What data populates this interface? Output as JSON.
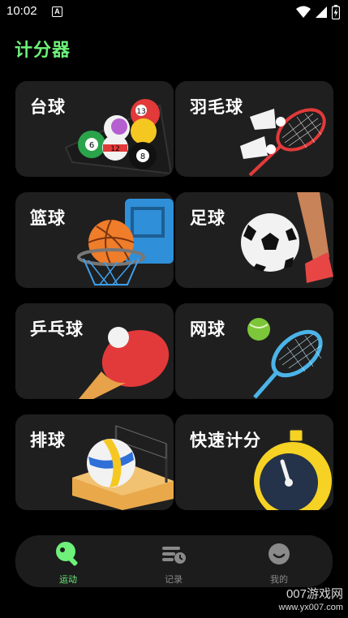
{
  "status_bar": {
    "time": "10:02",
    "notification_letter": "A"
  },
  "app": {
    "title": "计分器"
  },
  "sports": [
    {
      "label": "台球"
    },
    {
      "label": "羽毛球"
    },
    {
      "label": "篮球"
    },
    {
      "label": "足球"
    },
    {
      "label": "乒乓球"
    },
    {
      "label": "网球"
    },
    {
      "label": "排球"
    },
    {
      "label": "快速计分"
    }
  ],
  "nav": {
    "items": [
      {
        "label": "运动",
        "active": true,
        "icon": "ping-pong-paddle-icon"
      },
      {
        "label": "记录",
        "active": false,
        "icon": "records-icon"
      },
      {
        "label": "我的",
        "active": false,
        "icon": "profile-icon"
      }
    ],
    "active_color": "#6ef07a",
    "inactive_color": "#8a8a8a"
  },
  "watermark": {
    "line1": "007游戏网",
    "line2": "www.yx007.com"
  },
  "colors": {
    "accent": "#6ef07a",
    "card_bg": "#1f1f1f",
    "background": "#000000"
  }
}
